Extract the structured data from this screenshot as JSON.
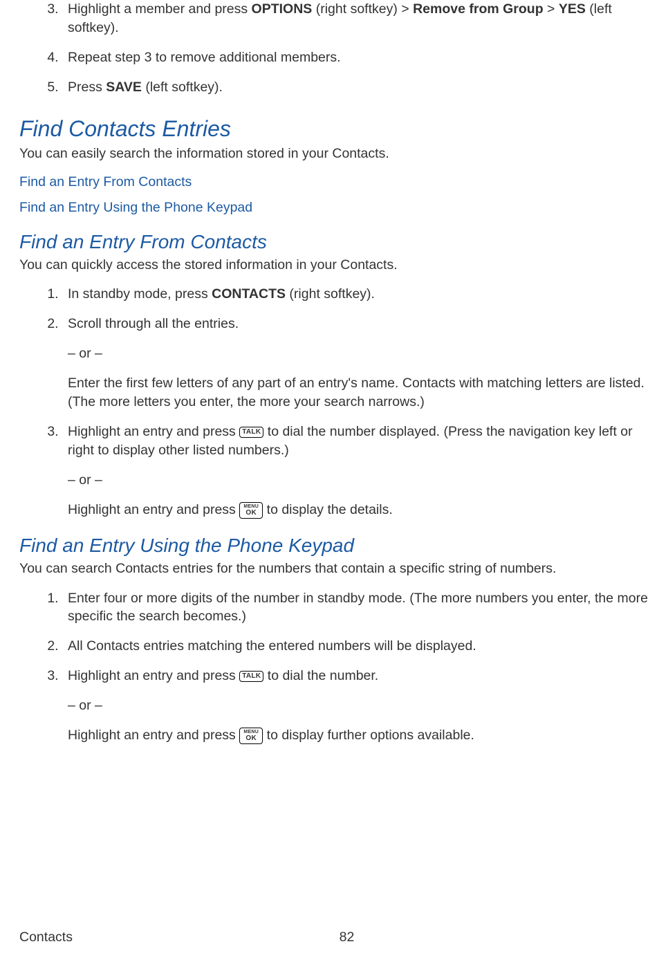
{
  "list1": {
    "start": 3,
    "item3_a": "Highlight a member and press ",
    "item3_b": "OPTIONS",
    "item3_c": " (right softkey) > ",
    "item3_d": "Remove from Group",
    "item3_e": " > ",
    "item3_f": "YES",
    "item3_g": " (left softkey).",
    "item4": "Repeat step 3 to remove additional members.",
    "item5_a": "Press ",
    "item5_b": "SAVE",
    "item5_c": " (left softkey)."
  },
  "section1": {
    "title": "Find Contacts Entries",
    "intro": "You can easily search the information stored in your Contacts.",
    "link1": "Find an Entry From Contacts",
    "link2": "Find an Entry Using the Phone Keypad"
  },
  "section2": {
    "title": "Find an Entry From Contacts",
    "intro": "You can quickly access the stored information in your Contacts.",
    "item1_a": "In standby mode, press ",
    "item1_b": "CONTACTS",
    "item1_c": " (right softkey).",
    "item2": "Scroll through all the entries.",
    "or": "– or –",
    "item2b": "Enter the first few letters of any part of an entry's name. Contacts with matching letters are listed. (The more letters you enter, the more your search narrows.)",
    "item3_a": "Highlight an entry and press ",
    "item3_b": " to dial the number displayed. (Press the navigation key left or right to display other listed numbers.)",
    "item3c_a": "Highlight an entry and press ",
    "item3c_b": " to display the details."
  },
  "section3": {
    "title": "Find an Entry Using the Phone Keypad",
    "intro": "You can search Contacts entries for the numbers that contain a specific string of numbers.",
    "item1": "Enter four or more digits of the number in standby mode. (The more numbers you enter, the more specific the search becomes.)",
    "item2": "All Contacts entries matching the entered numbers will be displayed.",
    "item3_a": " Highlight an entry and press ",
    "item3_b": " to dial the number.",
    "or": "– or –",
    "item3c_a": "Highlight an entry and press ",
    "item3c_b": " to display further options available."
  },
  "keys": {
    "talk": "TALK",
    "menu": "MENU",
    "ok": "OK"
  },
  "footer": {
    "left": "Contacts",
    "page": "82"
  }
}
